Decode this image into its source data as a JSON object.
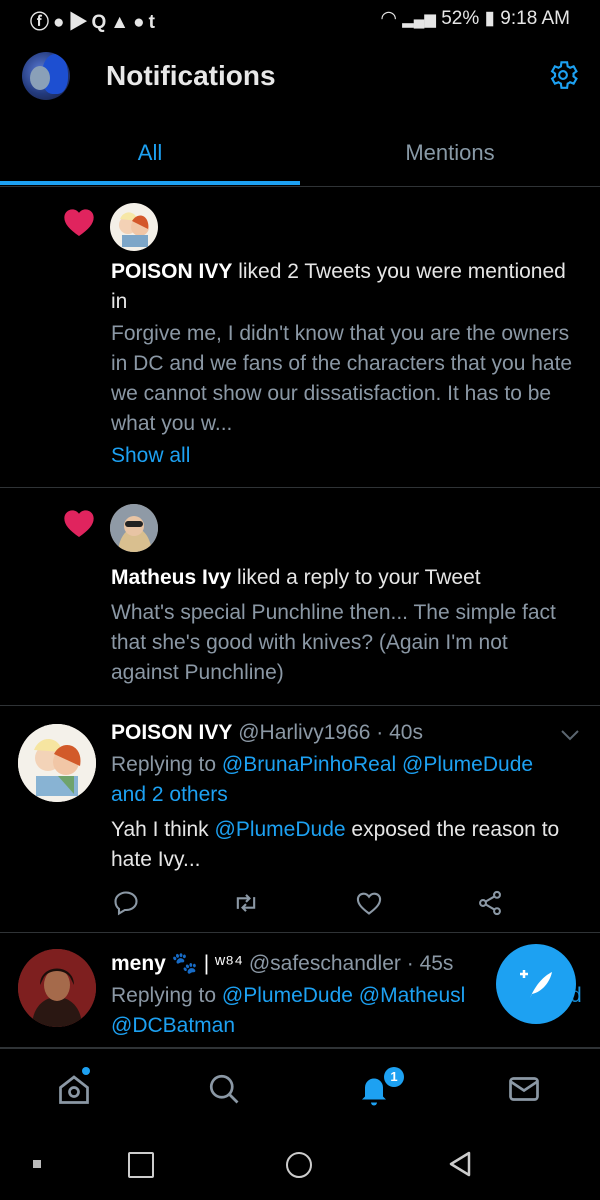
{
  "status_bar": {
    "app_icons": [
      "facebook-icon",
      "reddit-icon",
      "youtube-icon",
      "quora-icon",
      "warning-icon",
      "messenger-icon",
      "tumblr-icon"
    ],
    "battery": "52%",
    "time": "9:18 AM"
  },
  "header": {
    "title": "Notifications"
  },
  "tabs": [
    {
      "label": "All",
      "active": true
    },
    {
      "label": "Mentions",
      "active": false
    }
  ],
  "notifications": [
    {
      "type": "like",
      "user": "POISON IVY",
      "action": " liked 2 Tweets you were mentioned in",
      "preview": "Forgive me, I didn't know that you are the owners in DC and we fans of the characters that you hate we cannot show our dissatisfaction. It has to be what you w...",
      "show_all": "Show all"
    },
    {
      "type": "like",
      "user": "Matheus Ivy",
      "action": " liked a reply to your Tweet",
      "preview": "What's special Punchline then... The simple fact that she's good with knives? (Again I'm not against Punchline)"
    }
  ],
  "tweets": [
    {
      "name": "POISON IVY",
      "handle": "@Harlivy1966",
      "time": "· 40s",
      "replying_label": "Replying to ",
      "replying_1": "@BrunaPinhoReal",
      "replying_2": " @PlumeDude",
      "replying_3": "and 2 others",
      "body_1": "Yah I think ",
      "body_mention": "@PlumeDude",
      "body_2": " exposed the reason to hate Ivy..."
    },
    {
      "name": "meny",
      "name_suffix": "| ʷ⁸⁴",
      "handle": "@safeschandler",
      "time": "· 45s",
      "replying_label": "Replying to ",
      "replying_1": "@PlumeDude",
      "replying_2": " @Matheusl",
      "replying_2b": "d",
      "replying_3": "@DCBatman"
    }
  ],
  "bottom_nav": {
    "notification_count": "1"
  },
  "colors": {
    "accent": "#1da1f2",
    "heart": "#e0245e",
    "background": "#000000",
    "muted": "#8b98a5"
  }
}
